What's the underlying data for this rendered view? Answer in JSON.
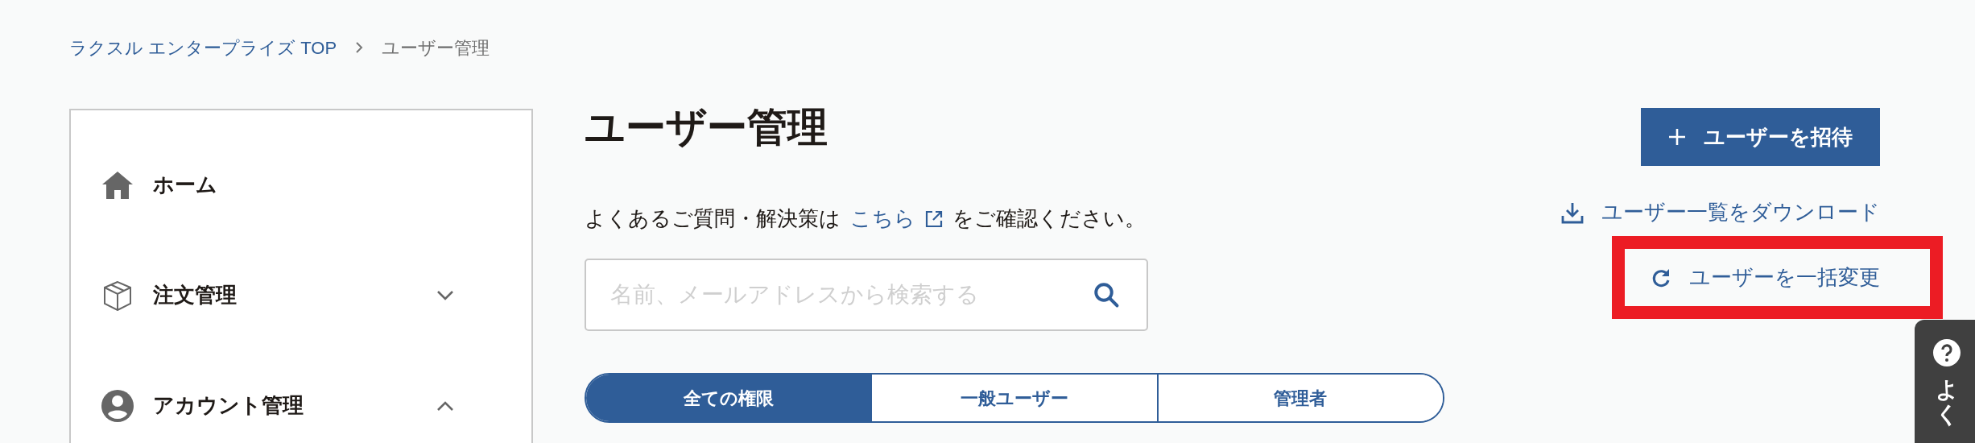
{
  "breadcrumb": [
    {
      "label": "ラクスル エンタープライズ TOP",
      "kind": "link"
    },
    {
      "label": "ユーザー管理",
      "kind": "current"
    }
  ],
  "sidebar": {
    "items": [
      {
        "label": "ホーム",
        "kind": "link"
      },
      {
        "label": "注文管理",
        "kind": "group",
        "expanded": false
      },
      {
        "label": "アカウント管理",
        "kind": "group",
        "expanded": true
      }
    ]
  },
  "page_title": "ユーザー管理",
  "faq_note": {
    "before": "よくあるご質問・解決策は",
    "link": "こちら",
    "after": "をご確認ください。"
  },
  "search": {
    "placeholder": "名前、メールアドレスから検索する"
  },
  "tabs": [
    {
      "label": "全ての権限",
      "selected": true
    },
    {
      "label": "一般ユーザー",
      "selected": false
    },
    {
      "label": "管理者",
      "selected": false
    }
  ],
  "actions": {
    "invite_button": "ユーザーを招待",
    "download_link": "ユーザー一覧をダウンロード",
    "bulk_change_link": {
      "label": "ユーザーを一括変更",
      "highlighted": true
    }
  },
  "help_tab": {
    "label": "よく"
  }
}
